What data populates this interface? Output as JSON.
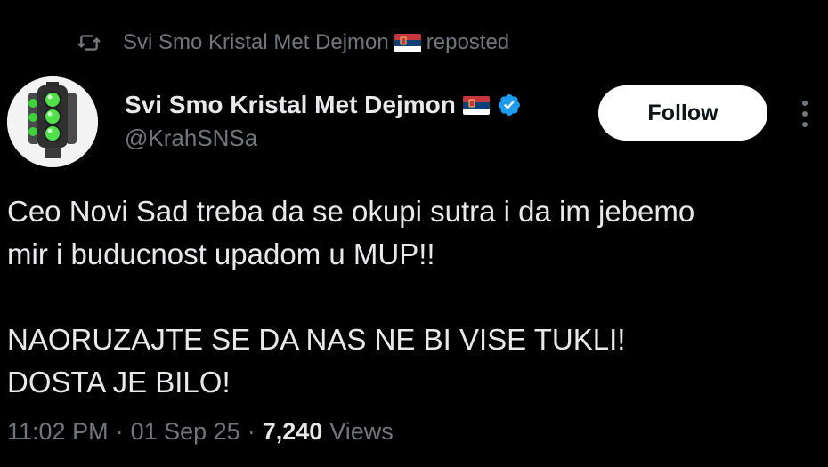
{
  "repost": {
    "icon": "repost-icon",
    "user": "Svi Smo Kristal Met Dejmon",
    "label": "reposted"
  },
  "author": {
    "name": "Svi Smo Kristal Met Dejmon",
    "handle": "@KrahSNSa",
    "flag": "serbia-flag-emoji",
    "verified_icon": "verified-badge-icon",
    "avatar": "traffic-light-avatar"
  },
  "follow_button": {
    "label": "Follow"
  },
  "more_icon": "more-options-icon",
  "tweet": {
    "lines_1": [
      "Ceo Novi Sad treba da se okupi sutra i da im jebemo",
      "mir i buducnost upadom u MUP!!"
    ],
    "lines_2": [
      "NAORUZAJTE SE DA NAS NE BI VISE TUKLI!",
      "DOSTA JE BILO!"
    ]
  },
  "meta": {
    "time": "11:02 PM",
    "date": "01 Sep 25",
    "separator": "·",
    "views_count": "7,240",
    "views_label": "Views"
  },
  "colors": {
    "background": "#000000",
    "text_primary": "#e7e9ea",
    "text_secondary": "#71767b",
    "verified_blue": "#1d9bf0",
    "follow_bg": "#ffffff"
  }
}
